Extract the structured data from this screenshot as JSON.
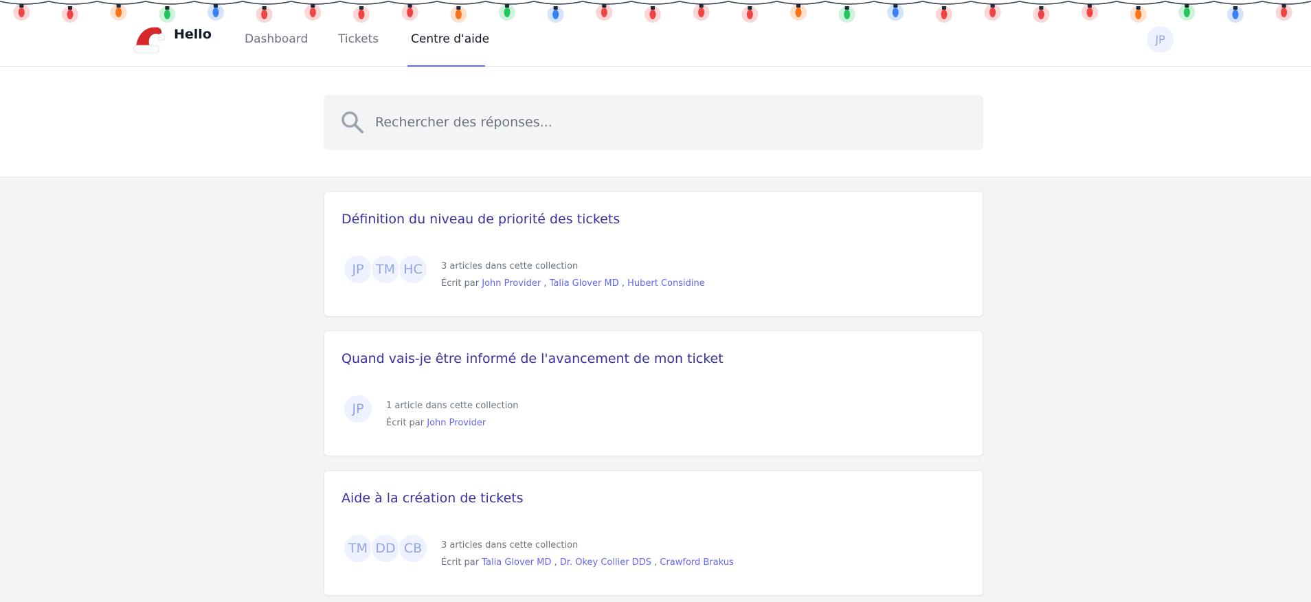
{
  "nav": {
    "brand": "Hello",
    "links": [
      {
        "label": "Dashboard"
      },
      {
        "label": "Tickets"
      },
      {
        "label": "Centre d'aide"
      }
    ],
    "user_initials": "JP"
  },
  "search": {
    "placeholder": "Rechercher des réponses...",
    "value": ""
  },
  "collections": [
    {
      "title": "Définition du niveau de priorité des tickets",
      "avatars": [
        "JP",
        "TM",
        "HC"
      ],
      "count_text": "3 articles dans cette collection",
      "written_by": "Écrit par",
      "authors": [
        "John Provider",
        "Talia Glover MD",
        "Hubert Considine"
      ]
    },
    {
      "title": "Quand vais-je être informé de l'avancement de mon ticket",
      "avatars": [
        "JP"
      ],
      "count_text": "1 article dans cette collection",
      "written_by": "Écrit par",
      "authors": [
        "John Provider"
      ]
    },
    {
      "title": "Aide à la création de tickets",
      "avatars": [
        "TM",
        "DD",
        "CB"
      ],
      "count_text": "3 articles dans cette collection",
      "written_by": "Écrit par",
      "authors": [
        "Talia Glover MD",
        "Dr. Okey Collier DDS",
        "Crawford Brakus"
      ]
    }
  ],
  "colors": {
    "accent": "#6366f1",
    "title": "#3730a3",
    "avatar_bg": "#eef2ff",
    "page_bg": "#f3f4f6",
    "light_red": "#ef4444",
    "light_green": "#22c55e",
    "light_blue": "#3b82f6",
    "light_orange": "#f97316"
  },
  "decorations": {
    "string_lights": [
      "red",
      "red",
      "orange",
      "green",
      "blue",
      "red",
      "red",
      "red",
      "red",
      "orange",
      "green",
      "blue",
      "red",
      "red",
      "red",
      "red",
      "orange",
      "green",
      "blue",
      "red",
      "red",
      "red",
      "red",
      "orange",
      "green",
      "blue",
      "red"
    ]
  }
}
